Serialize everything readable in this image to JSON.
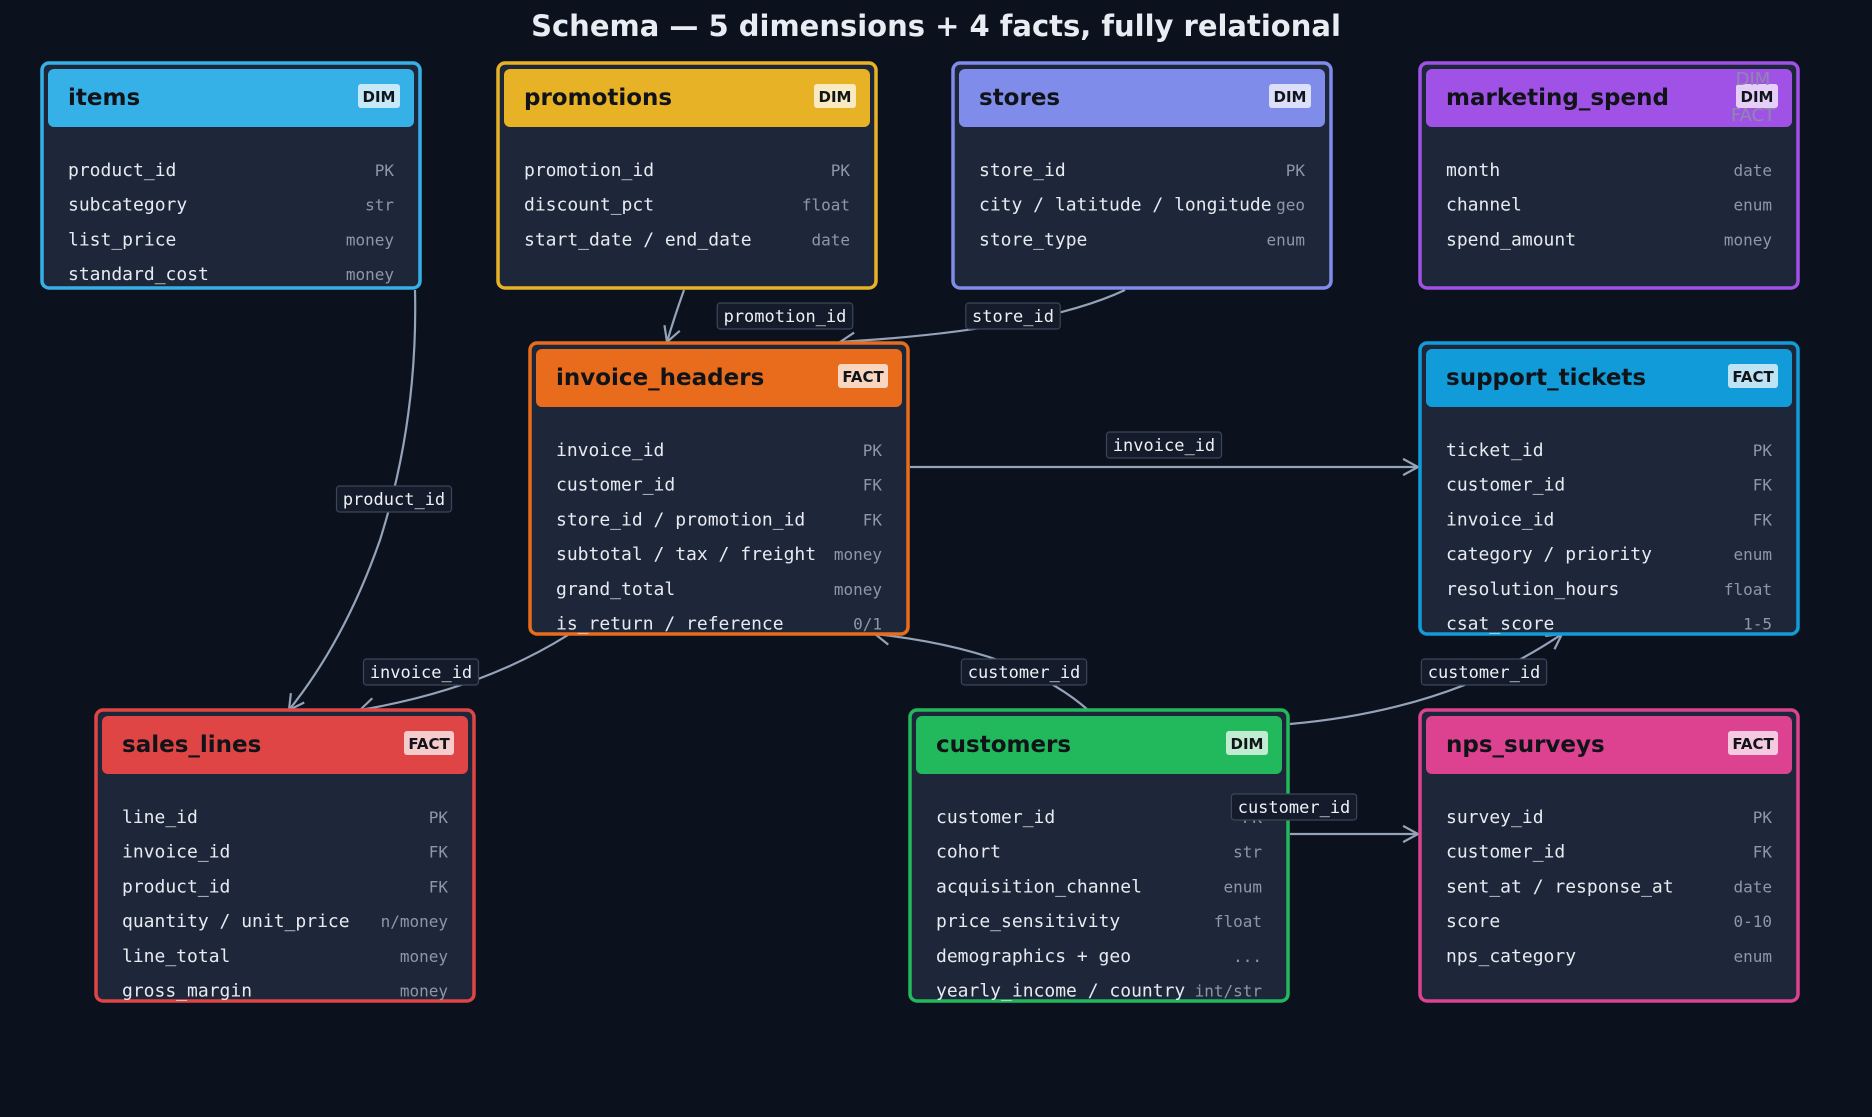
{
  "title": "Schema — 5 dimensions + 4 facts, fully relational",
  "tables": [
    {
      "id": "items",
      "name": "items",
      "badge": "DIM",
      "color": "#35b1e7",
      "columns": [
        {
          "name": "product_id",
          "type": "PK"
        },
        {
          "name": "subcategory",
          "type": "str"
        },
        {
          "name": "list_price",
          "type": "money"
        },
        {
          "name": "standard_cost",
          "type": "money"
        }
      ]
    },
    {
      "id": "promotions",
      "name": "promotions",
      "badge": "DIM",
      "color": "#e8b226",
      "columns": [
        {
          "name": "promotion_id",
          "type": "PK"
        },
        {
          "name": "discount_pct",
          "type": "float"
        },
        {
          "name": "start_date / end_date",
          "type": "date"
        }
      ]
    },
    {
      "id": "stores",
      "name": "stores",
      "badge": "DIM",
      "color": "#7f8ce9",
      "columns": [
        {
          "name": "store_id",
          "type": "PK"
        },
        {
          "name": "city / latitude / longitude",
          "type": "geo"
        },
        {
          "name": "store_type",
          "type": "enum"
        }
      ]
    },
    {
      "id": "marketing_spend",
      "name": "marketing_spend",
      "badge": "DIM",
      "color": "#a052e6",
      "ghost_label": [
        "DIM",
        "FACT"
      ],
      "columns": [
        {
          "name": "month",
          "type": "date"
        },
        {
          "name": "channel",
          "type": "enum"
        },
        {
          "name": "spend_amount",
          "type": "money"
        }
      ]
    },
    {
      "id": "invoice_headers",
      "name": "invoice_headers",
      "badge": "FACT",
      "color": "#e86c1c",
      "columns": [
        {
          "name": "invoice_id",
          "type": "PK"
        },
        {
          "name": "customer_id",
          "type": "FK"
        },
        {
          "name": "store_id / promotion_id",
          "type": "FK"
        },
        {
          "name": "subtotal / tax / freight",
          "type": "money"
        },
        {
          "name": "grand_total",
          "type": "money"
        },
        {
          "name": "is_return / reference",
          "type": "0/1"
        }
      ]
    },
    {
      "id": "support_tickets",
      "name": "support_tickets",
      "badge": "FACT",
      "color": "#129bd9",
      "columns": [
        {
          "name": "ticket_id",
          "type": "PK"
        },
        {
          "name": "customer_id",
          "type": "FK"
        },
        {
          "name": "invoice_id",
          "type": "FK"
        },
        {
          "name": "category / priority",
          "type": "enum"
        },
        {
          "name": "resolution_hours",
          "type": "float"
        },
        {
          "name": "csat_score",
          "type": "1-5"
        }
      ]
    },
    {
      "id": "sales_lines",
      "name": "sales_lines",
      "badge": "FACT",
      "color": "#df4545",
      "columns": [
        {
          "name": "line_id",
          "type": "PK"
        },
        {
          "name": "invoice_id",
          "type": "FK"
        },
        {
          "name": "product_id",
          "type": "FK"
        },
        {
          "name": "quantity / unit_price",
          "type": "n/money"
        },
        {
          "name": "line_total",
          "type": "money"
        },
        {
          "name": "gross_margin",
          "type": "money"
        }
      ]
    },
    {
      "id": "customers",
      "name": "customers",
      "badge": "DIM",
      "color": "#22b95c",
      "columns": [
        {
          "name": "customer_id",
          "type": "PK"
        },
        {
          "name": "cohort",
          "type": "str"
        },
        {
          "name": "acquisition_channel",
          "type": "enum"
        },
        {
          "name": "price_sensitivity",
          "type": "float"
        },
        {
          "name": "demographics + geo",
          "type": "..."
        },
        {
          "name": "yearly_income / country",
          "type": "int/str"
        }
      ]
    },
    {
      "id": "nps_surveys",
      "name": "nps_surveys",
      "badge": "FACT",
      "color": "#dc4290",
      "columns": [
        {
          "name": "survey_id",
          "type": "PK"
        },
        {
          "name": "customer_id",
          "type": "FK"
        },
        {
          "name": "sent_at / response_at",
          "type": "date"
        },
        {
          "name": "score",
          "type": "0-10"
        },
        {
          "name": "nps_category",
          "type": "enum"
        }
      ]
    }
  ],
  "relationships": [
    {
      "id": "promo",
      "from": "promotions",
      "to": "invoice_headers",
      "label": "promotion_id"
    },
    {
      "id": "store",
      "from": "stores",
      "to": "invoice_headers",
      "label": "store_id"
    },
    {
      "id": "prod",
      "from": "items",
      "to": "sales_lines",
      "label": "product_id"
    },
    {
      "id": "inv_sl",
      "from": "invoice_headers",
      "to": "sales_lines",
      "label": "invoice_id"
    },
    {
      "id": "inv_st",
      "from": "invoice_headers",
      "to": "support_tickets",
      "label": "invoice_id"
    },
    {
      "id": "cust_ih",
      "from": "customers",
      "to": "invoice_headers",
      "label": "customer_id"
    },
    {
      "id": "cust_st",
      "from": "customers",
      "to": "support_tickets",
      "label": "customer_id"
    },
    {
      "id": "cust_nps",
      "from": "customers",
      "to": "nps_surveys",
      "label": "customer_id"
    }
  ]
}
